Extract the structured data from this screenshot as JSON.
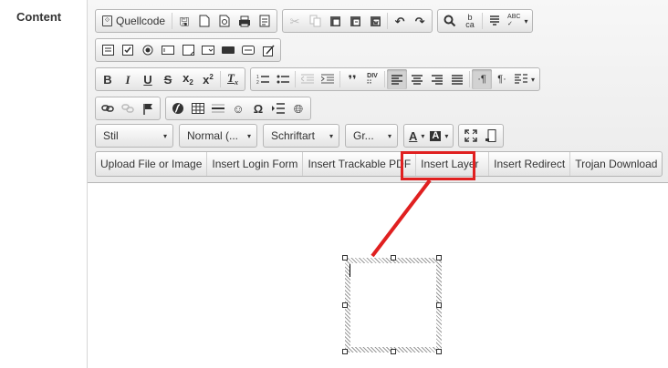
{
  "form": {
    "content_label": "Content"
  },
  "toolbar": {
    "row1": {
      "source_label": "Quellcode",
      "spell_label": "ABC"
    },
    "combos": {
      "style": "Stil",
      "format": "Normal (...",
      "font": "Schriftart",
      "size": "Gr..."
    },
    "color_text_label": "A",
    "color_bg_label": "A",
    "custom_buttons": [
      "Upload File or Image",
      "Insert Login Form",
      "Insert Trackable PDF",
      "Insert Layer",
      "Insert Redirect",
      "Trojan Download"
    ]
  },
  "highlight_color": "#e02020"
}
